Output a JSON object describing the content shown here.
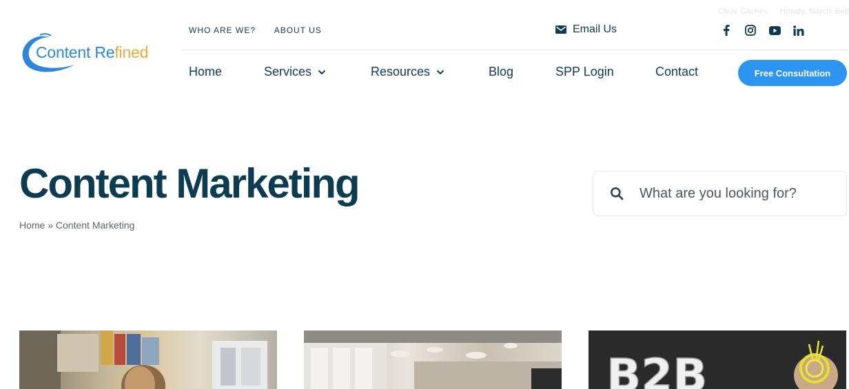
{
  "admin_bar": {
    "clear_caches": "Clear Caches",
    "howdy": "Howdy, Narcis Bejt"
  },
  "logo": {
    "text_part1": "Content Re",
    "text_part2": "fined"
  },
  "top_links": [
    "WHO ARE WE?",
    "ABOUT US"
  ],
  "email_us": "Email Us",
  "socials": [
    "facebook-icon",
    "instagram-icon",
    "youtube-icon",
    "linkedin-icon"
  ],
  "nav": {
    "items": [
      {
        "label": "Home",
        "has_dropdown": false
      },
      {
        "label": "Services",
        "has_dropdown": true
      },
      {
        "label": "Resources",
        "has_dropdown": true
      },
      {
        "label": "Blog",
        "has_dropdown": false
      },
      {
        "label": "SPP Login",
        "has_dropdown": false
      },
      {
        "label": "Contact",
        "has_dropdown": false
      }
    ],
    "cta_label": "Free Consultation"
  },
  "page": {
    "title": "Content Marketing",
    "breadcrumb": "Home » Content Marketing"
  },
  "search": {
    "placeholder": "What are you looking for?"
  },
  "cards": [
    {
      "image": "office-woman-photo"
    },
    {
      "image": "open-office-photo"
    },
    {
      "image": "b2b-chalkboard-photo",
      "overlay_text": "B2B"
    }
  ],
  "colors": {
    "primary_text": "#0d3b4f",
    "accent_blue": "#2d95f0",
    "logo_blue": "#2e86d6",
    "logo_gold": "#e8a93a"
  }
}
